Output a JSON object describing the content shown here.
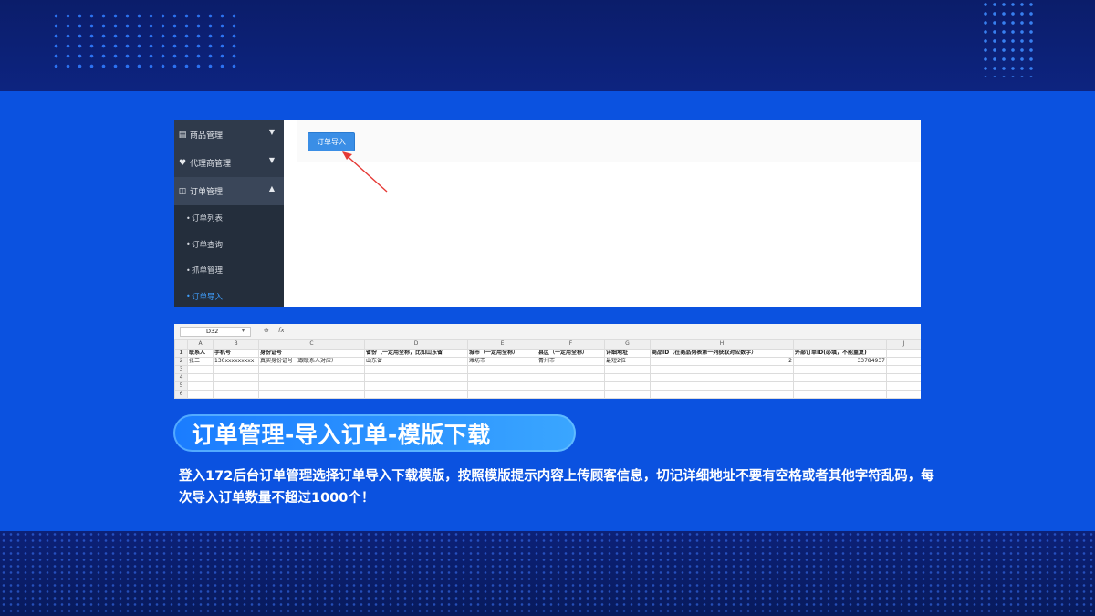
{
  "sidebar": {
    "items": [
      {
        "icon": "chart-icon",
        "label": "商品管理"
      },
      {
        "icon": "tag-icon",
        "label": "代理商管理"
      },
      {
        "icon": "orders-icon",
        "label": "订单管理"
      }
    ],
    "sub_items": [
      {
        "label": "订单列表"
      },
      {
        "label": "订单查询"
      },
      {
        "label": "抓单管理"
      },
      {
        "label": "订单导入"
      }
    ]
  },
  "content": {
    "import_button": "订单导入"
  },
  "sheet": {
    "cell_ref": "D32",
    "fx": "fx",
    "zoom_glyph": "⊕",
    "columns": [
      "A",
      "B",
      "C",
      "D",
      "E",
      "F",
      "G",
      "H",
      "I",
      "J"
    ],
    "rows": [
      [
        "联系人",
        "手机号",
        "身份证号",
        "省份（一定用全称，比如山东省",
        "城市（一定用全称）",
        "县区（一定用全称）",
        "详细地址",
        "商品ID（在商品列表第一列获取对应数字）",
        "外部订单ID(必填，不能重复)",
        ""
      ],
      [
        "张三",
        "130xxxxxxxxx",
        "真实身份证号（跟联系人对应）",
        "山东省",
        "潍坊市",
        "青州市",
        "最短2位",
        "2",
        "33784937",
        ""
      ],
      [
        "",
        "",
        "",
        "",
        "",
        "",
        "",
        "",
        "",
        ""
      ],
      [
        "",
        "",
        "",
        "",
        "",
        "",
        "",
        "",
        "",
        ""
      ],
      [
        "",
        "",
        "",
        "",
        "",
        "",
        "",
        "",
        "",
        ""
      ],
      [
        "",
        "",
        "",
        "",
        "",
        "",
        "",
        "",
        "",
        ""
      ]
    ],
    "row_numbers": [
      "1",
      "2",
      "3",
      "4",
      "5",
      "6"
    ]
  },
  "title": "订单管理-导入订单-模版下载",
  "description": "登入172后台订单管理选择订单导入下载模版，按照模版提示内容上传顾客信息，切记详细地址不要有空格或者其他字符乱码，每次导入订单数量不超过1000个！",
  "colors": {
    "main_bg": "#0b52e0",
    "dark_band": "#0b1d6a",
    "sidebar": "#2f3a4b",
    "button": "#3a8ee6",
    "active_sub": "#3fa0ff",
    "arrow": "#e53935"
  }
}
